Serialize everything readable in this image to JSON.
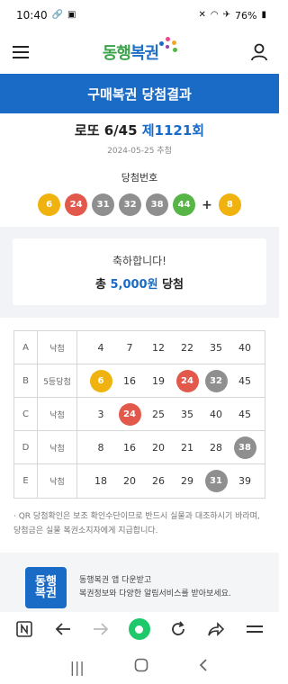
{
  "status_bar": {
    "time": "10:40",
    "battery": "76%"
  },
  "header": {
    "logo_text_a": "동행",
    "logo_text_b": "복권"
  },
  "title_bar": {
    "title": "구매복권 당첨결과"
  },
  "draw": {
    "game": "로또 6/45 ",
    "round": "제1121회",
    "date": "2024-05-25 추첨"
  },
  "winning": {
    "label": "당첨번호",
    "numbers": [
      {
        "value": "6",
        "color": "#f0b20e"
      },
      {
        "value": "24",
        "color": "#e2594b"
      },
      {
        "value": "31",
        "color": "#8f8f8f"
      },
      {
        "value": "32",
        "color": "#8f8f8f"
      },
      {
        "value": "38",
        "color": "#8f8f8f"
      },
      {
        "value": "44",
        "color": "#56b546"
      }
    ],
    "plus": "+",
    "bonus": {
      "value": "8",
      "color": "#f0b20e"
    }
  },
  "result": {
    "congrats": "축하합니다!",
    "total_prefix": "총 ",
    "amount": "5,000원",
    "total_suffix": " 당첨"
  },
  "ticket": [
    {
      "game": "A",
      "result": "낙첨",
      "nums": [
        "4",
        "7",
        "12",
        "22",
        "35",
        "40"
      ],
      "hits": [
        null,
        null,
        null,
        null,
        null,
        null
      ]
    },
    {
      "game": "B",
      "result": "5등당첨",
      "nums": [
        "6",
        "16",
        "19",
        "24",
        "32",
        "45"
      ],
      "hits": [
        "#f0b20e",
        null,
        null,
        "#e2594b",
        "#8f8f8f",
        null
      ]
    },
    {
      "game": "C",
      "result": "낙첨",
      "nums": [
        "3",
        "24",
        "25",
        "35",
        "40",
        "45"
      ],
      "hits": [
        null,
        "#e2594b",
        null,
        null,
        null,
        null
      ]
    },
    {
      "game": "D",
      "result": "낙첨",
      "nums": [
        "8",
        "16",
        "20",
        "21",
        "28",
        "38"
      ],
      "hits": [
        null,
        null,
        null,
        null,
        null,
        "#8f8f8f"
      ]
    },
    {
      "game": "E",
      "result": "낙첨",
      "nums": [
        "18",
        "20",
        "26",
        "29",
        "31",
        "39"
      ],
      "hits": [
        null,
        null,
        null,
        null,
        "#8f8f8f",
        null
      ]
    }
  ],
  "notice": "· QR 당첨확인은 보조 확인수단이므로 반드시 실물과 대조하시기 바라며, 당첨금은 실물 복권소지자에게 지급합니다.",
  "app_banner": {
    "icon_line1": "동행",
    "icon_line2": "복권",
    "line1": "동행복권 앱 다운받고",
    "line2": "복권정보와 다양한 알림서비스를 받아보세요."
  },
  "colors": {
    "primary": "#1a6bc5",
    "green": "#1ec86b"
  }
}
